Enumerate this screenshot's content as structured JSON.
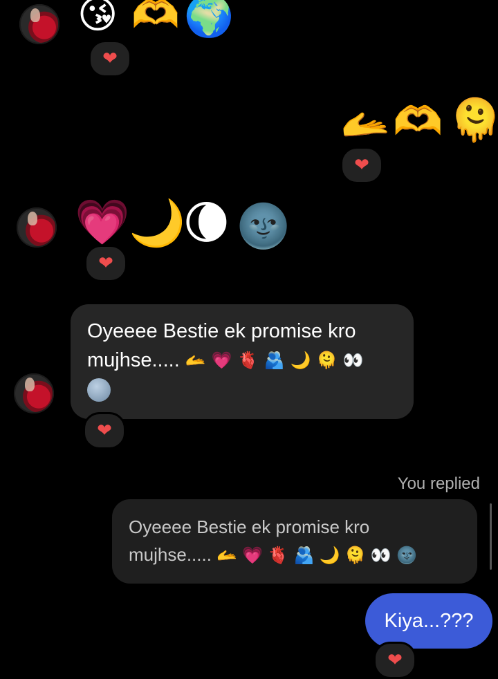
{
  "messages": [
    {
      "type": "emoji",
      "emojis": [
        "😘",
        "🫶",
        "🌍"
      ]
    },
    {
      "type": "emoji",
      "emojis": [
        "🫴",
        "🫶",
        "🫠"
      ]
    },
    {
      "type": "emoji",
      "emojis": [
        "💗",
        "🌙",
        "🌘",
        "🌚"
      ]
    },
    {
      "type": "text",
      "text_line1": "Oyeeee Bestie ek promise kro",
      "text_line2": "mujhse.....",
      "emojis_inline": [
        "🫴",
        "💗",
        "🫀",
        "🫂",
        "🌙",
        "🫠",
        "👀"
      ],
      "emoji_line3": "🌚"
    },
    {
      "type": "reply_label",
      "text": "You replied"
    },
    {
      "type": "quoted_reply",
      "text_line1": "Oyeeee Bestie ek promise kro",
      "text_line2": "mujhse.....",
      "emojis_inline": [
        "🫴",
        "💗",
        "🫀",
        "🫂",
        "🌙",
        "🫠",
        "👀",
        "🌚"
      ]
    },
    {
      "type": "sent",
      "text": "Kiya...???"
    }
  ],
  "reaction": "❤",
  "colors": {
    "background": "#000000",
    "bubble": "#262626",
    "sent_bubble": "#3c5bd8",
    "reaction_heart": "#ef4d4d"
  }
}
